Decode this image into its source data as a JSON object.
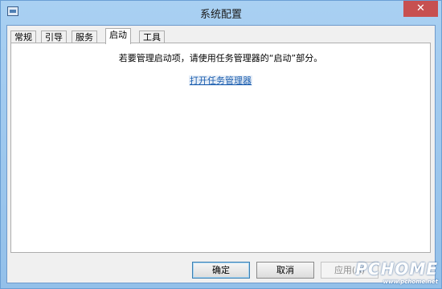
{
  "window": {
    "title": "系统配置",
    "close_symbol": "✕"
  },
  "tabs": [
    {
      "label": "常规",
      "active": false
    },
    {
      "label": "引导",
      "active": false
    },
    {
      "label": "服务",
      "active": false
    },
    {
      "label": "启动",
      "active": true
    },
    {
      "label": "工具",
      "active": false
    }
  ],
  "startup": {
    "message": "若要管理启动项，请使用任务管理器的“启动”部分。",
    "link": "打开任务管理器"
  },
  "buttons": {
    "ok": "确定",
    "cancel": "取消",
    "apply": "应用(A)"
  },
  "watermark": {
    "logo": "PCHOME",
    "url": "www.pchome.net"
  }
}
